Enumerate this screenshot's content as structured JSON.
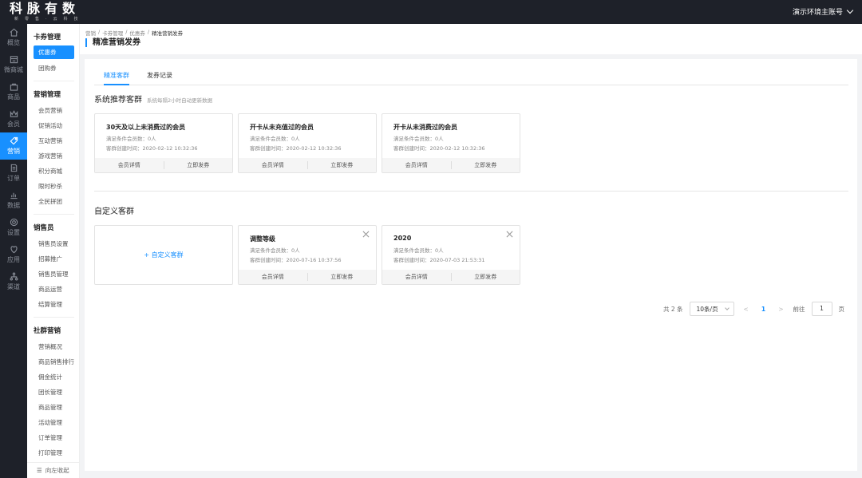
{
  "brand": {
    "name": "科脉有数",
    "tagline": "新零售·云科技"
  },
  "account": {
    "label": "演示环境主账号"
  },
  "rail": [
    {
      "icon": "home-icon",
      "label": "概览"
    },
    {
      "icon": "store-icon",
      "label": "微商城"
    },
    {
      "icon": "bag-icon",
      "label": "商品"
    },
    {
      "icon": "crown-icon",
      "label": "会员"
    },
    {
      "icon": "tag-icon",
      "label": "营销",
      "active": true
    },
    {
      "icon": "order-icon",
      "label": "订单"
    },
    {
      "icon": "chart-icon",
      "label": "数据"
    },
    {
      "icon": "gear-icon",
      "label": "设置"
    },
    {
      "icon": "apps-icon",
      "label": "应用"
    },
    {
      "icon": "channel-icon",
      "label": "渠道"
    }
  ],
  "subnav": {
    "groups": [
      {
        "title": "卡券管理",
        "items": [
          "优惠券",
          "团购券"
        ]
      },
      {
        "title": "营销管理",
        "items": [
          "会员营销",
          "促销活动",
          "互动营销",
          "游戏营销",
          "积分商城",
          "限时秒杀",
          "全民拼团"
        ]
      },
      {
        "title": "销售员",
        "items": [
          "销售员设置",
          "招募推广",
          "销售员管理",
          "商品运营",
          "结算管理"
        ]
      },
      {
        "title": "社群营销",
        "items": [
          "营销概况",
          "商品销售排行",
          "佣金统计",
          "团长管理",
          "商品管理",
          "活动管理",
          "订单管理",
          "打印管理"
        ]
      }
    ],
    "collapse_label": "向左收起"
  },
  "breadcrumb": [
    "营销",
    "卡券管理",
    "优惠券",
    "精准营销发券"
  ],
  "page_title": "精准营销发券",
  "tabs": [
    "精准客群",
    "发券记录"
  ],
  "recommended": {
    "title": "系统推荐客群",
    "subtitle": "系统每隔2小时自动更新数据",
    "cards": [
      {
        "title": "30天及以上未消费过的会员",
        "count": "满足条件会员数：0人",
        "created": "客群创建时间：2020-02-12 10:32:36",
        "detail": "会员详情",
        "send": "立即发券"
      },
      {
        "title": "开卡从未充值过的会员",
        "count": "满足条件会员数：0人",
        "created": "客群创建时间：2020-02-12 10:32:36",
        "detail": "会员详情",
        "send": "立即发券"
      },
      {
        "title": "开卡从未消费过的会员",
        "count": "满足条件会员数：0人",
        "created": "客群创建时间：2020-02-12 10:32:36",
        "detail": "会员详情",
        "send": "立即发券"
      }
    ]
  },
  "custom": {
    "title": "自定义客群",
    "add_label": "+ 自定义客群",
    "cards": [
      {
        "title": "调整等级",
        "count": "满足条件会员数：0人",
        "created": "客群创建时间：2020-07-16 10:37:56",
        "detail": "会员详情",
        "send": "立即发券"
      },
      {
        "title": "2020",
        "count": "满足条件会员数：0人",
        "created": "客群创建时间：2020-07-03 21:53:31",
        "detail": "会员详情",
        "send": "立即发券"
      }
    ]
  },
  "pagination": {
    "total": "共 2 条",
    "page_size": "10条/页",
    "prev": "<",
    "current": "1",
    "next": ">",
    "goto": "前往",
    "goto_value": "1",
    "page_unit": "页"
  },
  "colors": {
    "accent": "#1890ff",
    "topbar": "#1e2129"
  }
}
